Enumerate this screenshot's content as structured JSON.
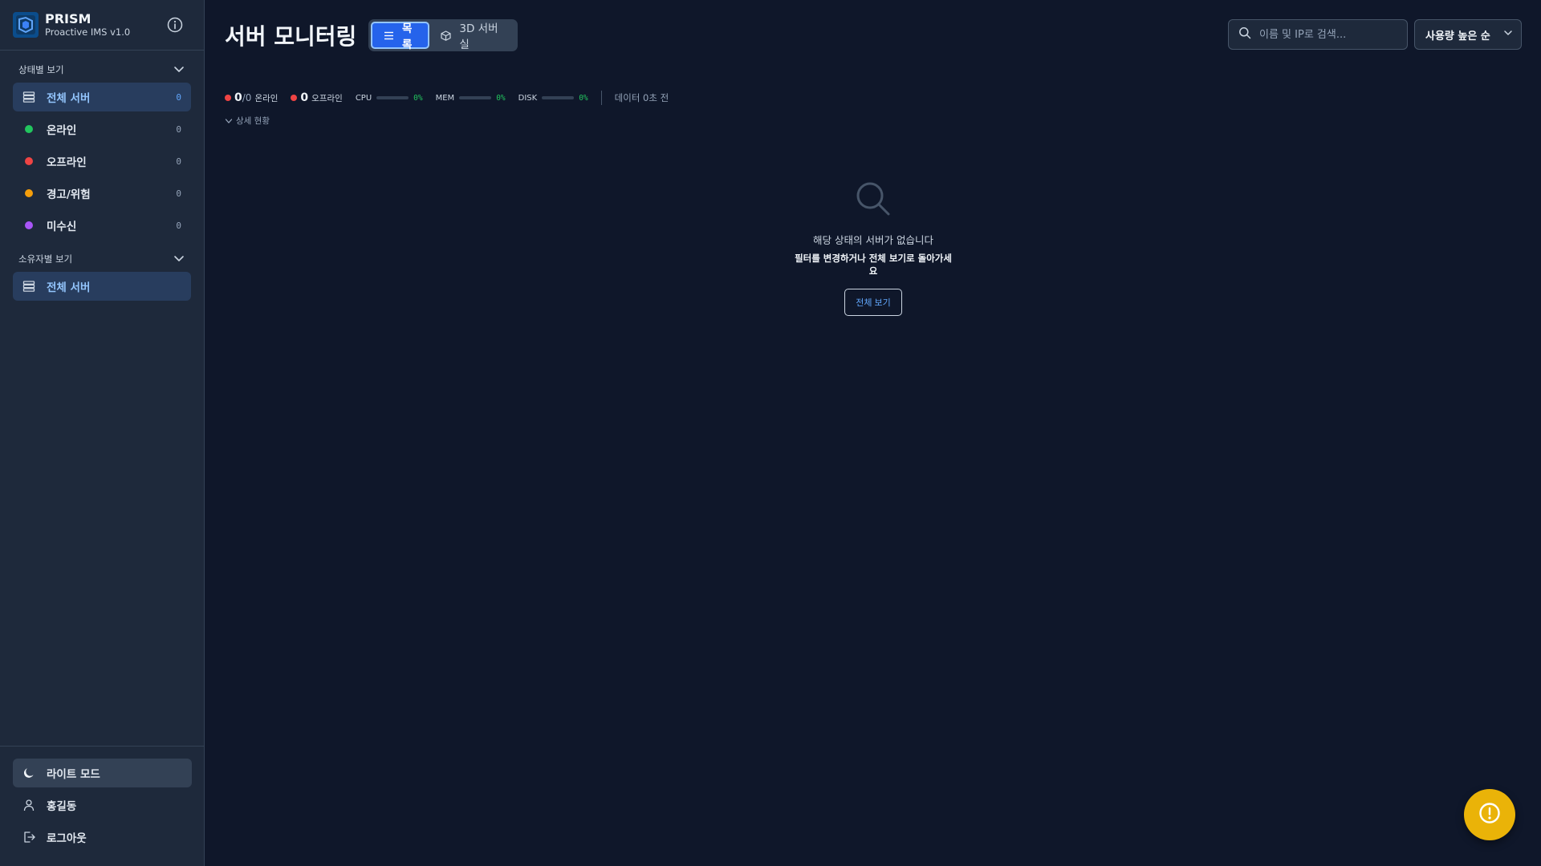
{
  "brand": {
    "name": "PRISM",
    "subtitle": "Proactive IMS v1.0"
  },
  "sidebar": {
    "status_section": {
      "title": "상태별 보기"
    },
    "status_items": [
      {
        "label": "전체 서버",
        "count": "0",
        "icon": "server-icon"
      },
      {
        "label": "온라인",
        "count": "0",
        "color": "#22c55e"
      },
      {
        "label": "오프라인",
        "count": "0",
        "color": "#ef4444"
      },
      {
        "label": "경고/위험",
        "count": "0",
        "color": "#f59e0b"
      },
      {
        "label": "미수신",
        "count": "0",
        "color": "#a855f7"
      }
    ],
    "owner_section": {
      "title": "소유자별 보기"
    },
    "owner_items": [
      {
        "label": "전체 서버",
        "icon": "server-icon"
      }
    ],
    "bottom": {
      "theme_label": "라이트 모드",
      "user_label": "홍길동",
      "logout_label": "로그아웃"
    }
  },
  "header": {
    "title": "서버 모니터링",
    "view_list_label": "목록",
    "view_3d_label": "3D 서버실",
    "search_placeholder": "이름 및 IP로 검색...",
    "sort_label": "사용량 높은 순"
  },
  "stats": {
    "online_count": "0",
    "online_total": "/0",
    "online_label": "온라인",
    "offline_count": "0",
    "offline_label": "오프라인",
    "cpu_label": "CPU",
    "cpu_value": "0%",
    "mem_label": "MEM",
    "mem_value": "0%",
    "disk_label": "DISK",
    "disk_value": "0%",
    "updated": "데이터 0초 전",
    "detail_toggle": "상세 현황"
  },
  "empty_state": {
    "title": "해당 상태의 서버가 없습니다",
    "subtitle": "필터를 변경하거나 전체 보기로 돌아가세요",
    "button": "전체 보기"
  },
  "colors": {
    "background": "#0f172a",
    "sidebar": "#1e293b",
    "accent": "#2563eb",
    "fab": "#eab308"
  }
}
